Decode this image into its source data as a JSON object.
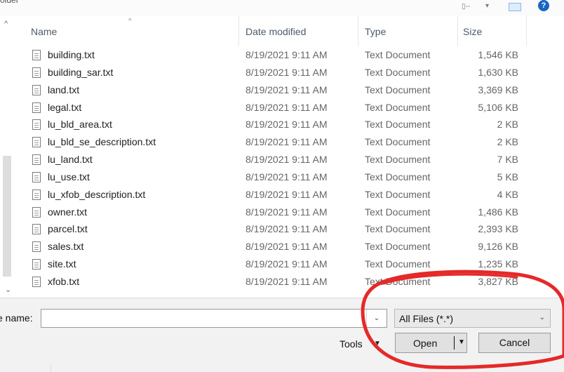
{
  "window": {
    "top_label": "older"
  },
  "columns": [
    "Name",
    "Date modified",
    "Type",
    "Size"
  ],
  "files": [
    {
      "name": "building.txt",
      "date": "8/19/2021 9:11 AM",
      "type": "Text Document",
      "size": "1,546 KB"
    },
    {
      "name": "building_sar.txt",
      "date": "8/19/2021 9:11 AM",
      "type": "Text Document",
      "size": "1,630 KB"
    },
    {
      "name": "land.txt",
      "date": "8/19/2021 9:11 AM",
      "type": "Text Document",
      "size": "3,369 KB"
    },
    {
      "name": "legal.txt",
      "date": "8/19/2021 9:11 AM",
      "type": "Text Document",
      "size": "5,106 KB"
    },
    {
      "name": "lu_bld_area.txt",
      "date": "8/19/2021 9:11 AM",
      "type": "Text Document",
      "size": "2 KB"
    },
    {
      "name": "lu_bld_se_description.txt",
      "date": "8/19/2021 9:11 AM",
      "type": "Text Document",
      "size": "2 KB"
    },
    {
      "name": "lu_land.txt",
      "date": "8/19/2021 9:11 AM",
      "type": "Text Document",
      "size": "7 KB"
    },
    {
      "name": "lu_use.txt",
      "date": "8/19/2021 9:11 AM",
      "type": "Text Document",
      "size": "5 KB"
    },
    {
      "name": "lu_xfob_description.txt",
      "date": "8/19/2021 9:11 AM",
      "type": "Text Document",
      "size": "4 KB"
    },
    {
      "name": "owner.txt",
      "date": "8/19/2021 9:11 AM",
      "type": "Text Document",
      "size": "1,486 KB"
    },
    {
      "name": "parcel.txt",
      "date": "8/19/2021 9:11 AM",
      "type": "Text Document",
      "size": "2,393 KB"
    },
    {
      "name": "sales.txt",
      "date": "8/19/2021 9:11 AM",
      "type": "Text Document",
      "size": "9,126 KB"
    },
    {
      "name": "site.txt",
      "date": "8/19/2021 9:11 AM",
      "type": "Text Document",
      "size": "1,235 KB"
    },
    {
      "name": "xfob.txt",
      "date": "8/19/2021 9:11 AM",
      "type": "Text Document",
      "size": "3,827 KB"
    }
  ],
  "bottom": {
    "filename_label": "e name:",
    "filename_value": "",
    "file_type": "All Files (*.*)",
    "tools": "Tools",
    "open": "Open",
    "cancel": "Cancel"
  },
  "icons": {
    "file": "text-file-icon",
    "dropdown": "chevron-down-icon",
    "help": "help-icon",
    "view": "view-options-icon",
    "preview": "preview-pane-icon"
  },
  "colors": {
    "annotation": "#e52929",
    "selected_button": "#e1e1e1",
    "bottom_background": "#f2f2f2"
  }
}
